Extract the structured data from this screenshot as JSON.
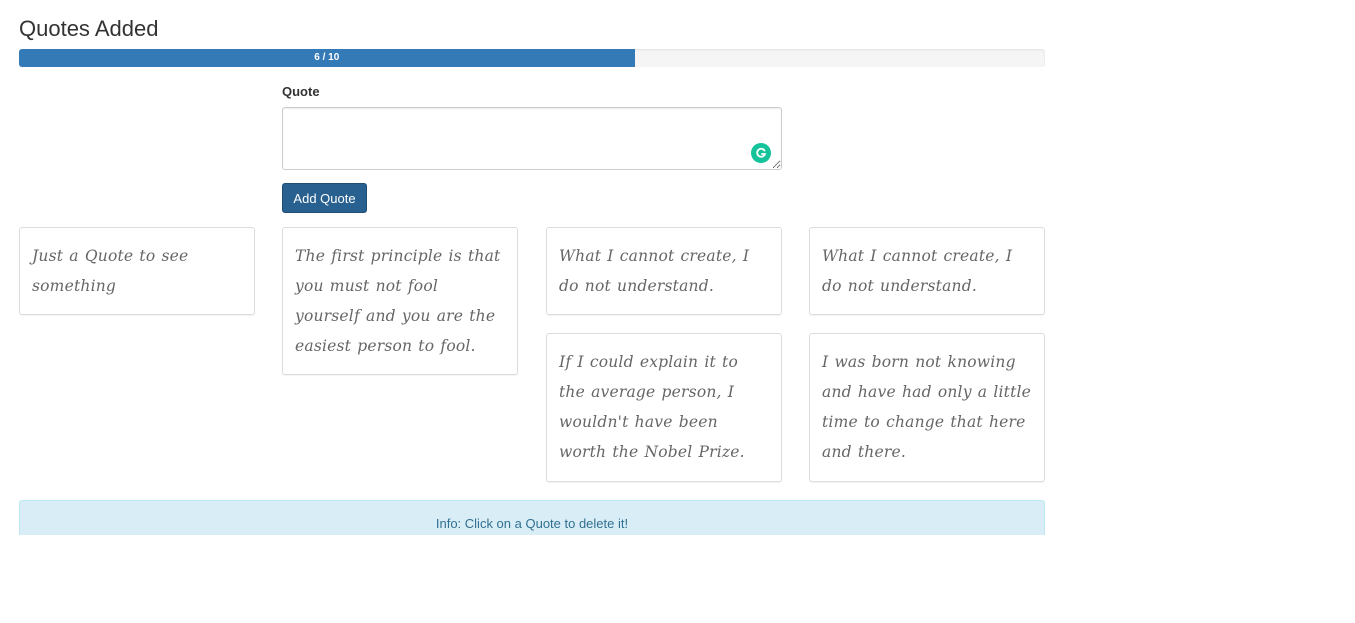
{
  "header": {
    "title": "Quotes Added"
  },
  "progress": {
    "label": "6 / 10",
    "current": 6,
    "max": 10,
    "fraction": 0.6
  },
  "form": {
    "label": "Quote",
    "value": "",
    "button_label": "Add Quote"
  },
  "quotes": [
    "Just a Quote to see something",
    "The first principle is that you must not fool yourself and you are the easiest person to fool.",
    "What I cannot create, I do not understand.",
    "What I cannot create, I do not understand.",
    "If I could explain it to the average person, I wouldn't have been worth the Nobel Prize.",
    "I was born not knowing and have had only a little time to change that here and there."
  ],
  "info": {
    "text": "Info: Click on a Quote to delete it!"
  },
  "colors": {
    "primary": "#337ab7",
    "button": "#286090",
    "info_bg": "#d9edf7",
    "grammarly": "#15c39a"
  },
  "icons": {
    "grammarly": "grammarly-icon"
  }
}
